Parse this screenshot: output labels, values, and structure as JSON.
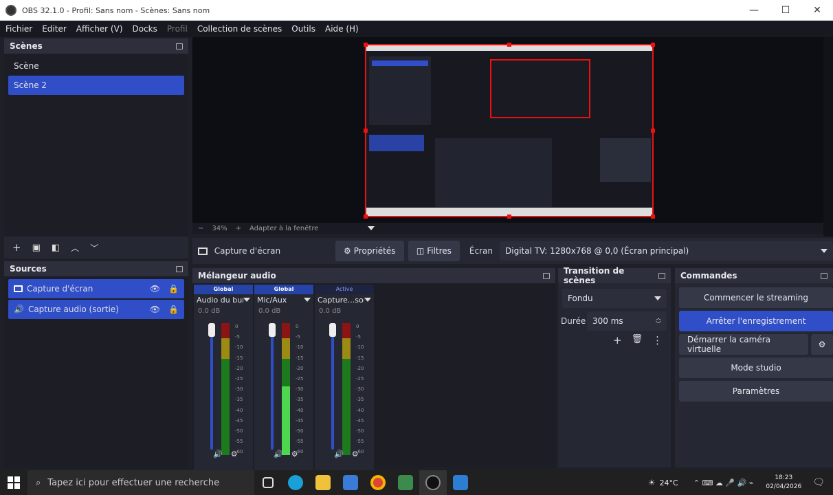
{
  "window": {
    "title": "OBS 32.1.0 - Profil: Sans nom - Scènes: Sans nom",
    "minimize": "—",
    "maximize": "☐",
    "close": "✕"
  },
  "menu": [
    "Fichier",
    "Editer",
    "Afficher (V)",
    "Docks",
    "Profil",
    "Collection de scènes",
    "Outils",
    "Aide (H)"
  ],
  "scenes": {
    "header": "Scènes",
    "items": [
      {
        "label": "Scène",
        "selected": false
      },
      {
        "label": "Scène 2",
        "selected": true
      }
    ]
  },
  "sources": {
    "header": "Sources",
    "items": [
      {
        "label": "Capture d'écran",
        "icon": "monitor-icon"
      },
      {
        "label": "Capture audio (sortie)",
        "icon": "speaker-icon"
      }
    ]
  },
  "preview": {
    "zoom": "34%",
    "zoom_minus": "−",
    "zoom_plus": "+",
    "fit": "Adapter à la fenêtre"
  },
  "source_toolbar": {
    "source_name": "Capture d'écran",
    "properties": "Propriétés",
    "filters": "Filtres",
    "screen_label": "Écran",
    "screen_value": "Digital TV: 1280x768 @ 0,0 (Écran principal)"
  },
  "audio_mixer": {
    "header": "Mélangeur audio",
    "channels": [
      {
        "tag": "Global",
        "name": "Audio du bureau",
        "db": "0.0 dB",
        "active": false
      },
      {
        "tag": "Global",
        "name": "Mic/Aux",
        "db": "0.0 dB",
        "active": false
      },
      {
        "tag": "Active",
        "name": "Capture...sortie)",
        "db": "0.0 dB",
        "active": true
      }
    ],
    "scale": [
      "0",
      "-5",
      "-10",
      "-15",
      "-20",
      "-25",
      "-30",
      "-35",
      "-40",
      "-45",
      "-50",
      "-55",
      "-60"
    ]
  },
  "transitions": {
    "header": "Transition de scènes",
    "type": "Fondu",
    "duration_label": "Durée",
    "duration_value": "300 ms"
  },
  "controls": {
    "header": "Commandes",
    "start_streaming": "Commencer le streaming",
    "stop_recording": "Arrêter l'enregistrement",
    "start_virtual_cam": "Démarrer la caméra virtuelle",
    "studio_mode": "Mode studio",
    "settings": "Paramètres"
  },
  "taskbar": {
    "search_placeholder": "Tapez ici pour effectuer une recherche",
    "weather": "24°C",
    "time": "18:23",
    "date": "02/04/2026"
  },
  "colors": {
    "accent": "#2f4ec7",
    "selection_red": "#e11111",
    "background": "#1f2027"
  }
}
